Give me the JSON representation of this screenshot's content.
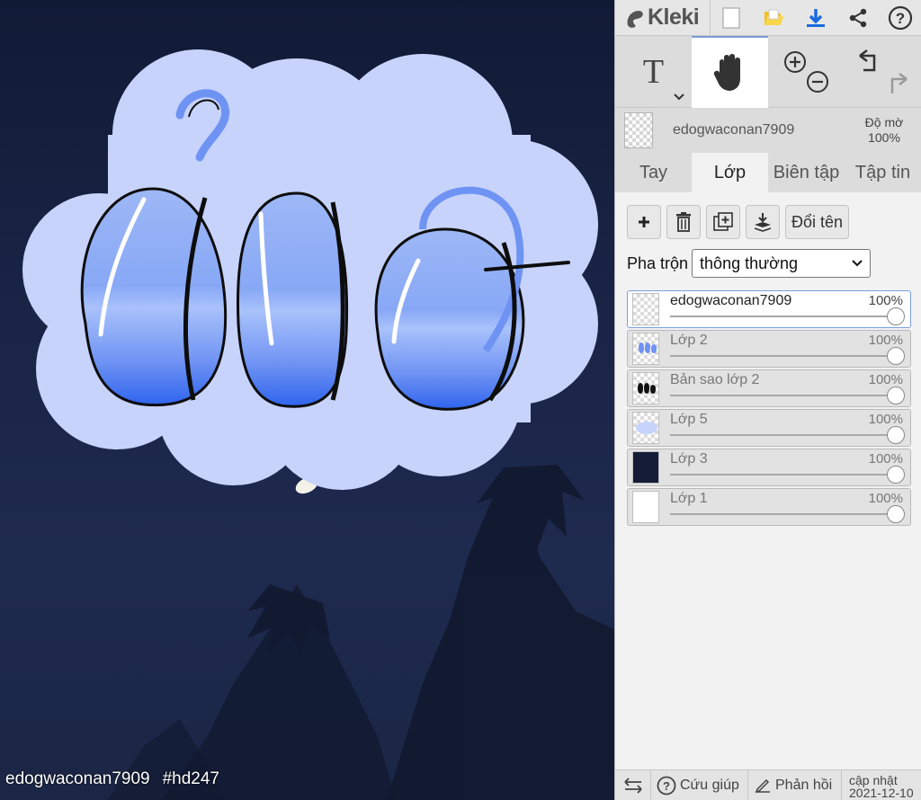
{
  "canvas": {
    "caption_user": "edogwaconan7909",
    "caption_tag": "#hd247"
  },
  "app": {
    "name": "Kleki",
    "toolbar_icons": [
      "new-file-icon",
      "open-folder-icon",
      "download-icon",
      "share-icon",
      "help-icon"
    ],
    "accent_color": "#7d9cd4",
    "download_color": "#1b6be0",
    "folder_color": "#f4c21c"
  },
  "tools": {
    "text_tool": "T",
    "active": "hand-tool",
    "icons": [
      "text-tool-icon",
      "hand-icon",
      "zoom-in-icon",
      "zoom-out-icon",
      "undo-icon",
      "redo-icon"
    ]
  },
  "current_layer": {
    "name": "edogwaconan7909",
    "opacity_label": "Độ mờ",
    "opacity_value": "100%"
  },
  "tabs": [
    {
      "label": "Tay",
      "active": false
    },
    {
      "label": "Lớp",
      "active": true
    },
    {
      "label": "Biên tập",
      "active": false
    },
    {
      "label": "Tập tin",
      "active": false
    }
  ],
  "layer_actions": {
    "rename_label": "Đổi tên",
    "icons": [
      "add-layer-icon",
      "delete-layer-icon",
      "duplicate-layer-icon",
      "merge-down-icon"
    ]
  },
  "blend": {
    "label": "Pha trộn",
    "value": "thông thường"
  },
  "layers": [
    {
      "name": "edogwaconan7909",
      "opacity": "100%",
      "opacity_fraction": 1.0,
      "active": true
    },
    {
      "name": "Lớp 2",
      "opacity": "100%",
      "opacity_fraction": 1.0,
      "active": false
    },
    {
      "name": "Bản sao lớp 2",
      "opacity": "100%",
      "opacity_fraction": 1.0,
      "active": false
    },
    {
      "name": "Lớp 5",
      "opacity": "100%",
      "opacity_fraction": 1.0,
      "active": false
    },
    {
      "name": "Lớp 3",
      "opacity": "100%",
      "opacity_fraction": 1.0,
      "active": false
    },
    {
      "name": "Lớp 1",
      "opacity": "100%",
      "opacity_fraction": 1.0,
      "active": false
    }
  ],
  "footer": {
    "help_label": "Cứu giúp",
    "feedback_label": "Phản hồi",
    "update_label": "cập nhật",
    "update_date": "2021-12-10"
  }
}
